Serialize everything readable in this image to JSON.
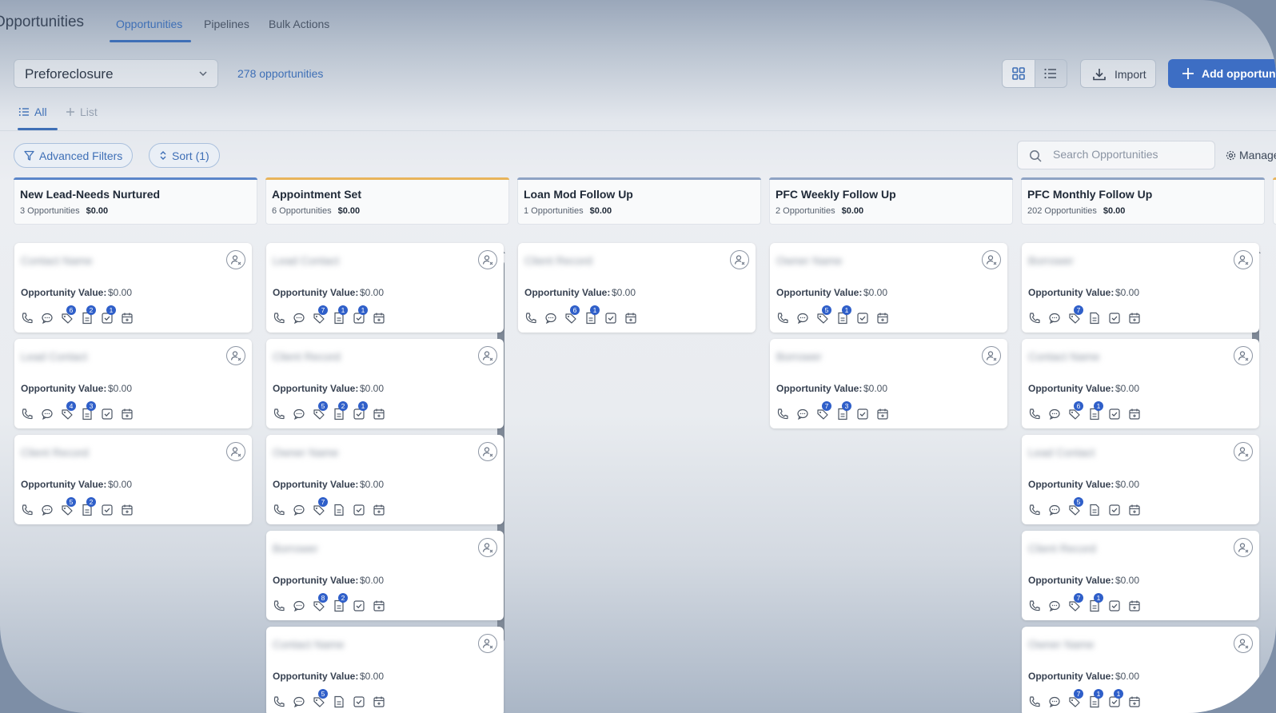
{
  "topnav": {
    "app_title": "Opportunities",
    "tabs": [
      {
        "label": "Opportunities",
        "active": true
      },
      {
        "label": "Pipelines",
        "active": false
      },
      {
        "label": "Bulk Actions",
        "active": false
      }
    ]
  },
  "toolbar": {
    "pipeline_value": "Preforeclosure",
    "opportunity_count": "278 opportunities",
    "import_label": "Import",
    "add_label": "Add opportunity"
  },
  "smart_lists": {
    "all_label": "All",
    "add_list_label": "List"
  },
  "filters": {
    "advanced_label": "Advanced Filters",
    "sort_label": "Sort (1)",
    "search_placeholder": "Search Opportunities",
    "manage_label": "Manage"
  },
  "colors": {
    "accent": "#3d6ec4",
    "badge": "#2f5fc9",
    "stage_bars": [
      "#5b86c9",
      "#e8b45a",
      "#8ea3c4",
      "#8ea3c4",
      "#8ea3c4"
    ]
  },
  "columns": [
    {
      "name": "New Lead-Needs Nurtured",
      "count": "3 Opportunities",
      "total": "$0.00",
      "cards": [
        {
          "value_label": "Opportunity Value:",
          "value": "$0.00",
          "badges": [
            "",
            "",
            "6",
            "2",
            "1",
            ""
          ]
        },
        {
          "value_label": "Opportunity Value:",
          "value": "$0.00",
          "badges": [
            "",
            "",
            "4",
            "3",
            "",
            ""
          ]
        },
        {
          "value_label": "Opportunity Value:",
          "value": "$0.00",
          "badges": [
            "",
            "",
            "5",
            "2",
            "",
            ""
          ]
        }
      ]
    },
    {
      "name": "Appointment Set",
      "count": "6 Opportunities",
      "total": "$0.00",
      "cards": [
        {
          "value_label": "Opportunity Value:",
          "value": "$0.00",
          "badges": [
            "",
            "",
            "7",
            "1",
            "1",
            ""
          ]
        },
        {
          "value_label": "Opportunity Value:",
          "value": "$0.00",
          "badges": [
            "",
            "",
            "5",
            "2",
            "1",
            ""
          ]
        },
        {
          "value_label": "Opportunity Value:",
          "value": "$0.00",
          "badges": [
            "",
            "",
            "7",
            "",
            "",
            ""
          ]
        },
        {
          "value_label": "Opportunity Value:",
          "value": "$0.00",
          "badges": [
            "",
            "",
            "8",
            "2",
            "",
            ""
          ]
        },
        {
          "value_label": "Opportunity Value:",
          "value": "$0.00",
          "badges": [
            "",
            "",
            "5",
            "",
            "",
            ""
          ]
        }
      ]
    },
    {
      "name": "Loan Mod Follow Up",
      "count": "1 Opportunities",
      "total": "$0.00",
      "cards": [
        {
          "value_label": "Opportunity Value:",
          "value": "$0.00",
          "badges": [
            "",
            "",
            "6",
            "1",
            "",
            ""
          ]
        }
      ]
    },
    {
      "name": "PFC Weekly Follow Up",
      "count": "2 Opportunities",
      "total": "$0.00",
      "cards": [
        {
          "value_label": "Opportunity Value:",
          "value": "$0.00",
          "badges": [
            "",
            "",
            "5",
            "1",
            "",
            ""
          ]
        },
        {
          "value_label": "Opportunity Value:",
          "value": "$0.00",
          "badges": [
            "",
            "",
            "7",
            "3",
            "",
            ""
          ]
        }
      ]
    },
    {
      "name": "PFC Monthly Follow Up",
      "count": "202 Opportunities",
      "total": "$0.00",
      "cards": [
        {
          "value_label": "Opportunity Value:",
          "value": "$0.00",
          "badges": [
            "",
            "",
            "7",
            "",
            "",
            ""
          ]
        },
        {
          "value_label": "Opportunity Value:",
          "value": "$0.00",
          "badges": [
            "",
            "",
            "6",
            "1",
            "",
            ""
          ]
        },
        {
          "value_label": "Opportunity Value:",
          "value": "$0.00",
          "badges": [
            "",
            "",
            "5",
            "",
            "",
            ""
          ]
        },
        {
          "value_label": "Opportunity Value:",
          "value": "$0.00",
          "badges": [
            "",
            "",
            "7",
            "1",
            "",
            ""
          ]
        },
        {
          "value_label": "Opportunity Value:",
          "value": "$0.00",
          "badges": [
            "",
            "",
            "7",
            "1",
            "1",
            ""
          ]
        }
      ]
    }
  ],
  "card_icons": [
    "phone-icon",
    "chat-icon",
    "tag-icon",
    "notes-icon",
    "task-icon",
    "calendar-icon"
  ]
}
